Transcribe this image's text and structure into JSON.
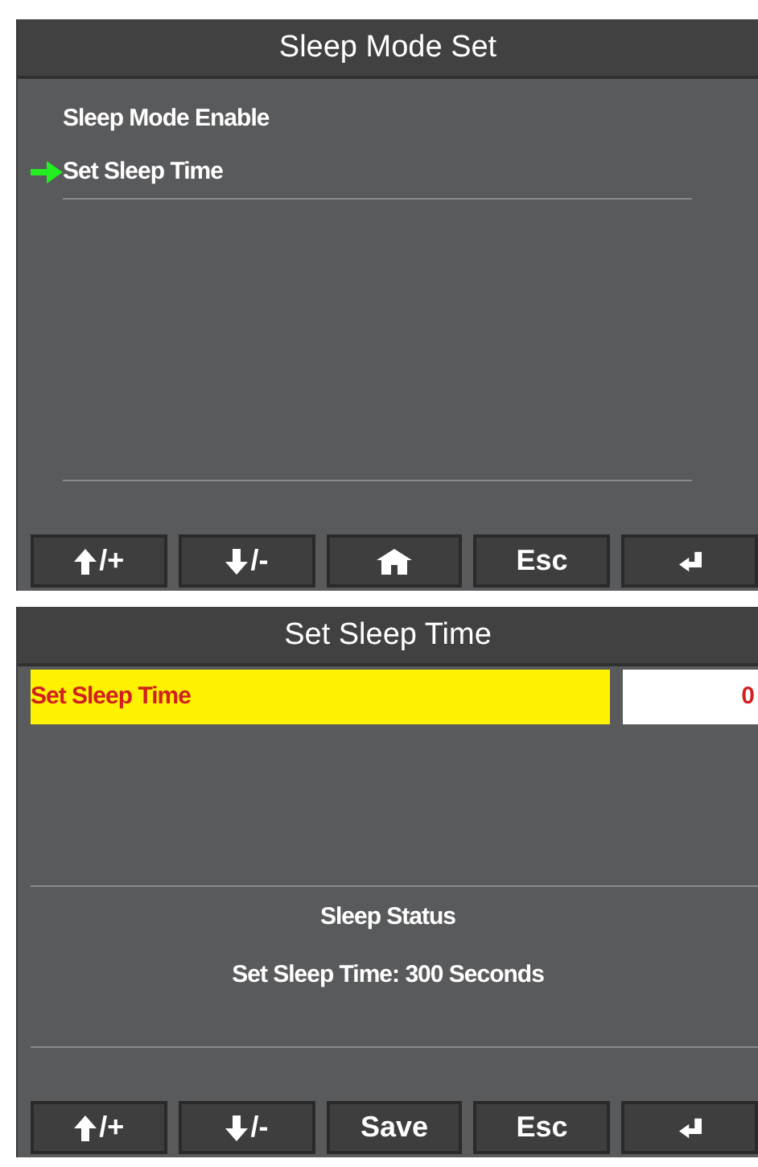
{
  "screens": [
    {
      "title": "Sleep Mode Set",
      "kind": "menu",
      "items": [
        {
          "label": "Sleep Mode Enable",
          "selected": false
        },
        {
          "label": "Set Sleep Time",
          "selected": true
        }
      ],
      "keys": [
        {
          "kind": "up",
          "label": "/+"
        },
        {
          "kind": "down",
          "label": "/-"
        },
        {
          "kind": "home"
        },
        {
          "kind": "text",
          "label": "Esc"
        },
        {
          "kind": "enter"
        }
      ]
    },
    {
      "title": "Set Sleep Time",
      "kind": "edit",
      "field": {
        "label": "Set Sleep Time",
        "value": "0",
        "focused": true
      },
      "status": {
        "heading": "Sleep Status",
        "text": "Set Sleep Time: 300 Seconds"
      },
      "keys": [
        {
          "kind": "up",
          "label": "/+"
        },
        {
          "kind": "down",
          "label": "/-"
        },
        {
          "kind": "text",
          "label": "Save"
        },
        {
          "kind": "text",
          "label": "Esc"
        },
        {
          "kind": "enter"
        }
      ]
    }
  ]
}
